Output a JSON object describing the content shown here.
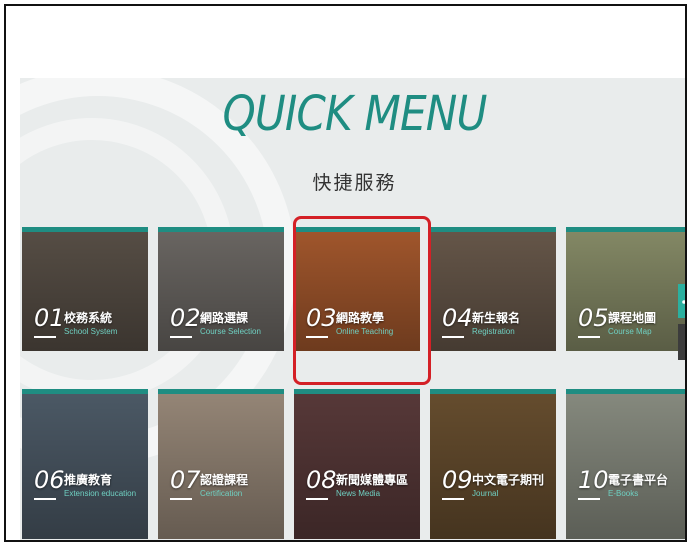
{
  "header": {
    "title": "QUICK MENU",
    "subtitle": "快捷服務"
  },
  "tiles": [
    {
      "num": "01",
      "label": "校務系統",
      "sub": "School System",
      "bg": "#5a5148"
    },
    {
      "num": "02",
      "label": "網路選課",
      "sub": "Course Selection",
      "bg": "#6e6a66"
    },
    {
      "num": "03",
      "label": "網路教學",
      "sub": "Online Teaching",
      "bg": "#a85a2e"
    },
    {
      "num": "04",
      "label": "新生報名",
      "sub": "Registration",
      "bg": "#6a5a4c"
    },
    {
      "num": "05",
      "label": "課程地圖",
      "sub": "Course Map",
      "bg": "#8a8f6a"
    },
    {
      "num": "06",
      "label": "推廣教育",
      "sub": "Extension education",
      "bg": "#4f5d6a"
    },
    {
      "num": "07",
      "label": "認證課程",
      "sub": "Certification",
      "bg": "#9c8c7c"
    },
    {
      "num": "08",
      "label": "新聞媒體專區",
      "sub": "News Media",
      "bg": "#5b3b3b"
    },
    {
      "num": "09",
      "label": "中文電子期刊",
      "sub": "Journal",
      "bg": "#6a5030"
    },
    {
      "num": "10",
      "label": "電子書平台",
      "sub": "E-Books",
      "bg": "#8c9084"
    }
  ],
  "side": {
    "share_icon": "share-icon",
    "top_label": "↑"
  }
}
